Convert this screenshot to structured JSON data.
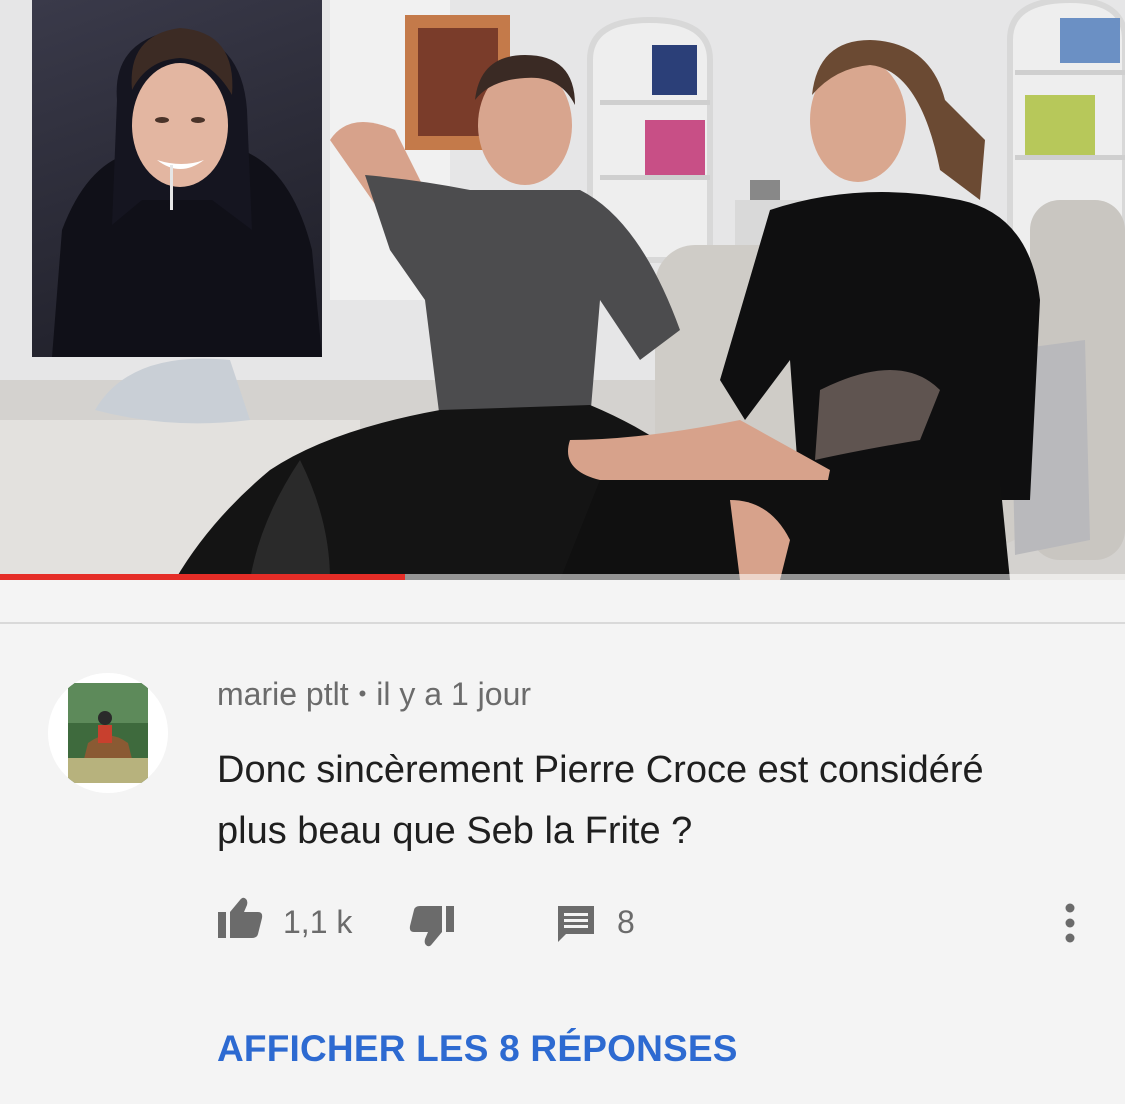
{
  "video": {
    "progress_fraction": 0.36,
    "colors": {
      "progress": "#e52d27",
      "track": "#ffffff"
    }
  },
  "comment": {
    "author": "marie ptlt",
    "separator": "•",
    "timestamp": "il y a 1 jour",
    "text_line1": "Donc sincèrement Pierre Croce est considéré",
    "text_line2": "plus beau que Seb la Frite ?",
    "like_count": "1,1 k",
    "reply_count": "8",
    "icons": [
      "thumb-up-icon",
      "thumb-down-icon",
      "comment-icon",
      "more-vert-icon"
    ]
  },
  "replies_link": "AFFICHER LES 8 RÉPONSES",
  "colors": {
    "link": "#2d6ad1",
    "meta": "#6b6b6b",
    "text": "#1f1f1f"
  }
}
